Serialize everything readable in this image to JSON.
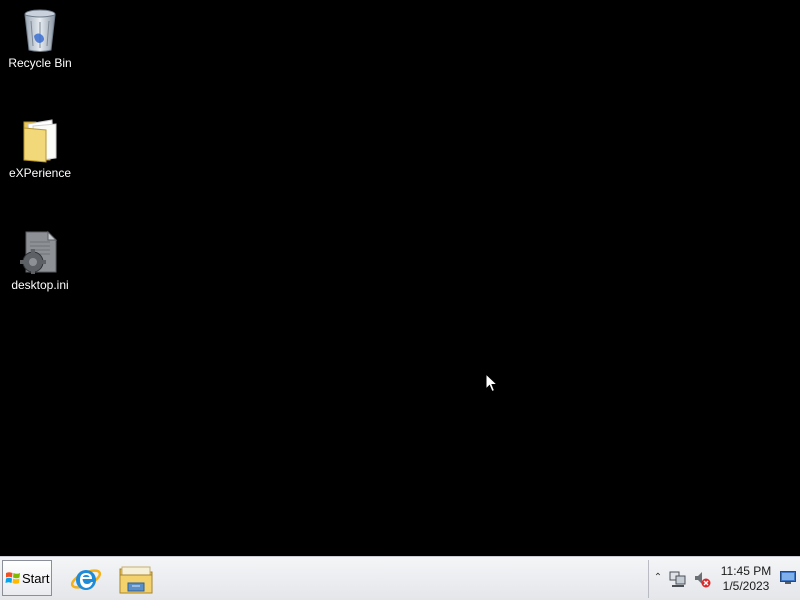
{
  "desktop": {
    "icons": [
      {
        "label": "Recycle Bin",
        "icon": "recycle-bin-icon"
      },
      {
        "label": "eXPerience",
        "icon": "folder-icon"
      },
      {
        "label": "desktop.ini",
        "icon": "config-file-icon"
      }
    ]
  },
  "taskbar": {
    "start_label": "Start",
    "pinned": [
      {
        "name": "internet-explorer",
        "icon": "internet-explorer-icon"
      },
      {
        "name": "file-explorer",
        "icon": "file-explorer-icon"
      }
    ],
    "tray": {
      "expand_icon": "chevron-up-icon",
      "network_icon": "network-icon",
      "volume_icon": "volume-muted-icon",
      "time": "11:45 PM",
      "date": "1/5/2023",
      "show_desktop_icon": "show-desktop-icon"
    }
  },
  "colors": {
    "desktop_background": "#000000",
    "taskbar_background": "#eceef1",
    "label_text": "#ffffff"
  }
}
